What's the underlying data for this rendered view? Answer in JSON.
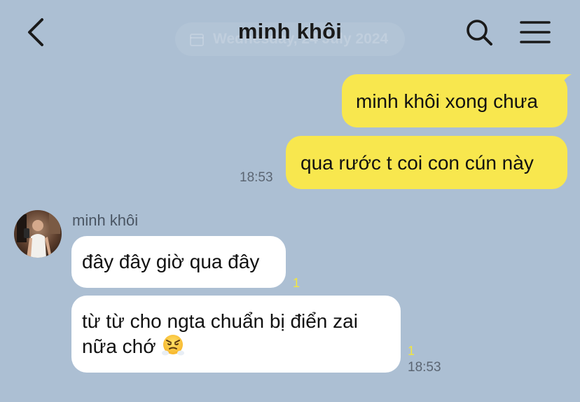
{
  "header": {
    "title": "minh khôi",
    "date_chip": "Wednesday, 24 July 2024"
  },
  "messages": [
    {
      "direction": "out",
      "text": "minh khôi xong chưa"
    },
    {
      "direction": "out",
      "text": "qua rước t coi con cún này",
      "time": "18:53"
    },
    {
      "direction": "in",
      "sender": "minh khôi",
      "text": "đây đây giờ qua đây",
      "unread": "1"
    },
    {
      "direction": "in",
      "text_line1": "từ từ cho ngta chuẩn bị điển zai",
      "text_line2": "nữa chớ",
      "emoji": "huffing-face",
      "unread": "1",
      "time": "18:53"
    }
  ],
  "colors": {
    "background": "#acbfd3",
    "outgoing_bubble": "#f8e74e",
    "incoming_bubble": "#ffffff",
    "unread": "#f2e63f"
  },
  "icons": [
    "back-chevron-icon",
    "search-icon",
    "menu-icon",
    "calendar-icon",
    "huffing-face-emoji"
  ]
}
